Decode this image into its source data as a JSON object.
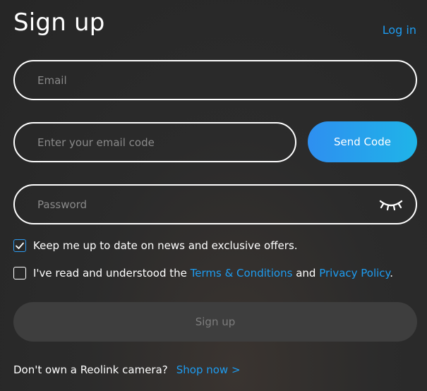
{
  "header": {
    "title": "Sign up",
    "login_link": "Log in"
  },
  "form": {
    "email_placeholder": "Email",
    "code_placeholder": "Enter your email code",
    "send_code_label": "Send Code",
    "password_placeholder": "Password",
    "password_toggle_icon": "eye-closed-icon"
  },
  "consent": {
    "newsletter": {
      "checked": true,
      "label": "Keep me up to date on news and exclusive offers."
    },
    "terms": {
      "checked": false,
      "prefix": "I've read and understood the ",
      "terms_link": "Terms & Conditions",
      "and": " and ",
      "privacy_link": "Privacy Policy",
      "suffix": "."
    }
  },
  "submit": {
    "label": "Sign up"
  },
  "footer": {
    "question": "Don't own a Reolink camera?",
    "shop_link": "Shop now >"
  },
  "colors": {
    "accent": "#1e9cf0",
    "background": "#2b2b2b",
    "disabled_button": "#3e3e3e"
  }
}
